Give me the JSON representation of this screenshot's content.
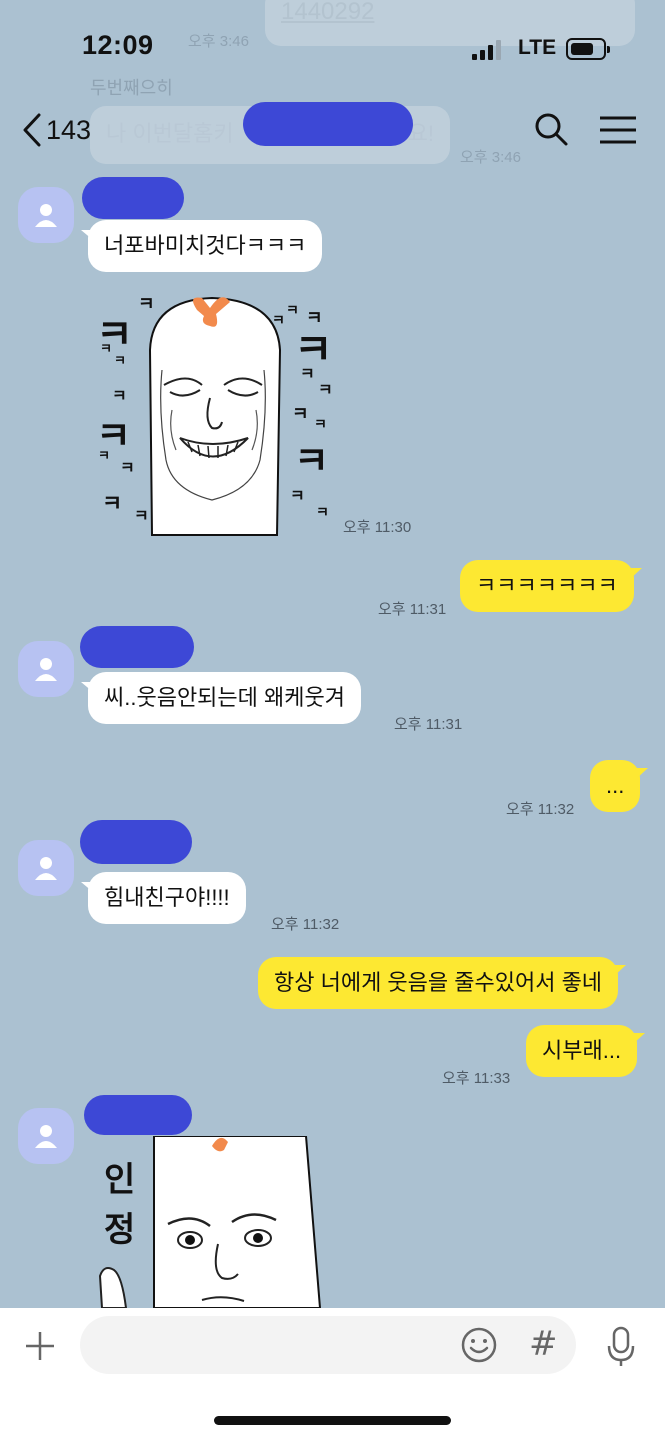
{
  "status_bar": {
    "time": "12:09",
    "network": "LTE"
  },
  "background_remnants": {
    "top_number": "1440292",
    "time_1": "오후 3:46",
    "name": "두번째으히",
    "message": "나 이번달홈키",
    "message_end": "요!",
    "time_2": "오후 3:46"
  },
  "header": {
    "back_count": "143",
    "icons": [
      "back-chevron-icon",
      "search-icon",
      "menu-icon"
    ]
  },
  "messages": [
    {
      "side": "in",
      "text": "너포바미치것다ㅋㅋㅋ"
    },
    {
      "side": "in",
      "type": "sticker",
      "time": "오후 11:30"
    },
    {
      "side": "out",
      "text": "ㅋㅋㅋㅋㅋㅋㅋ",
      "time": "오후 11:31"
    },
    {
      "side": "in",
      "text": "씨..웃음안되는데 왜케웃겨",
      "time": "오후 11:31"
    },
    {
      "side": "out",
      "text": "...",
      "time": "오후 11:32"
    },
    {
      "side": "in",
      "text": "힘내친구야!!!!",
      "time": "오후 11:32"
    },
    {
      "side": "out",
      "text": "항상 너에게 웃음을 줄수있어서 좋네"
    },
    {
      "side": "out",
      "text": "시부래...",
      "time": "오후 11:33"
    },
    {
      "side": "in",
      "type": "sticker"
    }
  ],
  "sticker2_text": [
    "인",
    "정"
  ],
  "colors": {
    "background": "#abc1d1",
    "incoming_bubble": "#ffffff",
    "outgoing_bubble": "#fde832",
    "redaction": "#3d48d6",
    "avatar": "#b7c2f2"
  },
  "input_bar": {
    "icons": [
      "plus-icon",
      "emoji-icon",
      "hashtag-icon",
      "mic-icon"
    ],
    "hashtag_label": "#"
  }
}
